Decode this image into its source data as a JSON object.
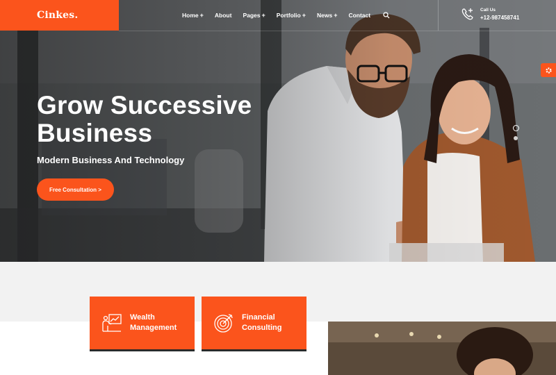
{
  "brand": {
    "logo": "Cinkes."
  },
  "nav": {
    "items": [
      {
        "label": "Home",
        "has_plus": true
      },
      {
        "label": "About",
        "has_plus": false
      },
      {
        "label": "Pages",
        "has_plus": true
      },
      {
        "label": "Portfolio",
        "has_plus": true
      },
      {
        "label": "News",
        "has_plus": true
      },
      {
        "label": "Contact",
        "has_plus": false
      }
    ],
    "plus_symbol": "+",
    "search_icon": "search-icon"
  },
  "call": {
    "label": "Call Us",
    "number": "+12-987458741",
    "icon": "phone-icon"
  },
  "hero": {
    "title_line1": "Grow Successive",
    "title_line2": "Business",
    "subtitle": "Modern Business And Technology",
    "cta_label": "Free Consultation >"
  },
  "services": [
    {
      "line1": "Wealth",
      "line2": "Management",
      "icon": "presentation-icon"
    },
    {
      "line1": "Financial",
      "line2": "Consulting",
      "icon": "target-icon"
    }
  ],
  "colors": {
    "accent": "#fb541c",
    "dark": "#2a2a2a",
    "band": "#f2f2f2"
  }
}
